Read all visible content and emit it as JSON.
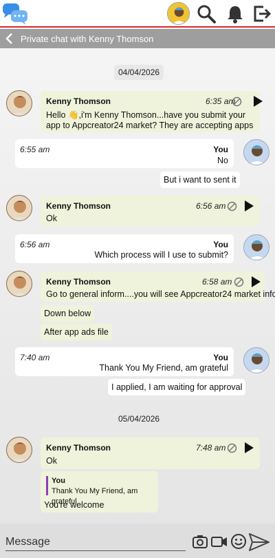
{
  "header": {
    "title": "Private chat with Kenny Thomson"
  },
  "composer": {
    "placeholder": "Message"
  },
  "dates": [
    "04/04/2026",
    "05/04/2026"
  ],
  "messages": [
    {
      "sender": "Kenny Thomson",
      "time": "6:35 am",
      "text": "Hello 👋,i'm Kenny Thomson...have you submit your app to Appcreator24 market? They are accepting apps"
    },
    {
      "sender": "You",
      "time": "6:55 am",
      "text": "No",
      "extra": [
        "But i want to sent it"
      ]
    },
    {
      "sender": "Kenny Thomson",
      "time": "6:56 am",
      "text": "Ok"
    },
    {
      "sender": "You",
      "time": "6:56 am",
      "text": "Which process will I use to submit?"
    },
    {
      "sender": "Kenny Thomson",
      "time": "6:58 am",
      "text": "Go to general inform....you will see Appcreator24 market info",
      "extra": [
        "Down below",
        "After app ads file"
      ]
    },
    {
      "sender": "You",
      "time": "7:40 am",
      "text": "Thank You My Friend, am grateful",
      "extra": [
        "I applied, I am waiting for approval"
      ]
    },
    {
      "sender": "Kenny Thomson",
      "time": "7:48 am",
      "text": "Ok",
      "reply": {
        "quote_name": "You",
        "quote_text": "Thank You My Friend, am grateful",
        "text": "You're welcome"
      }
    }
  ]
}
